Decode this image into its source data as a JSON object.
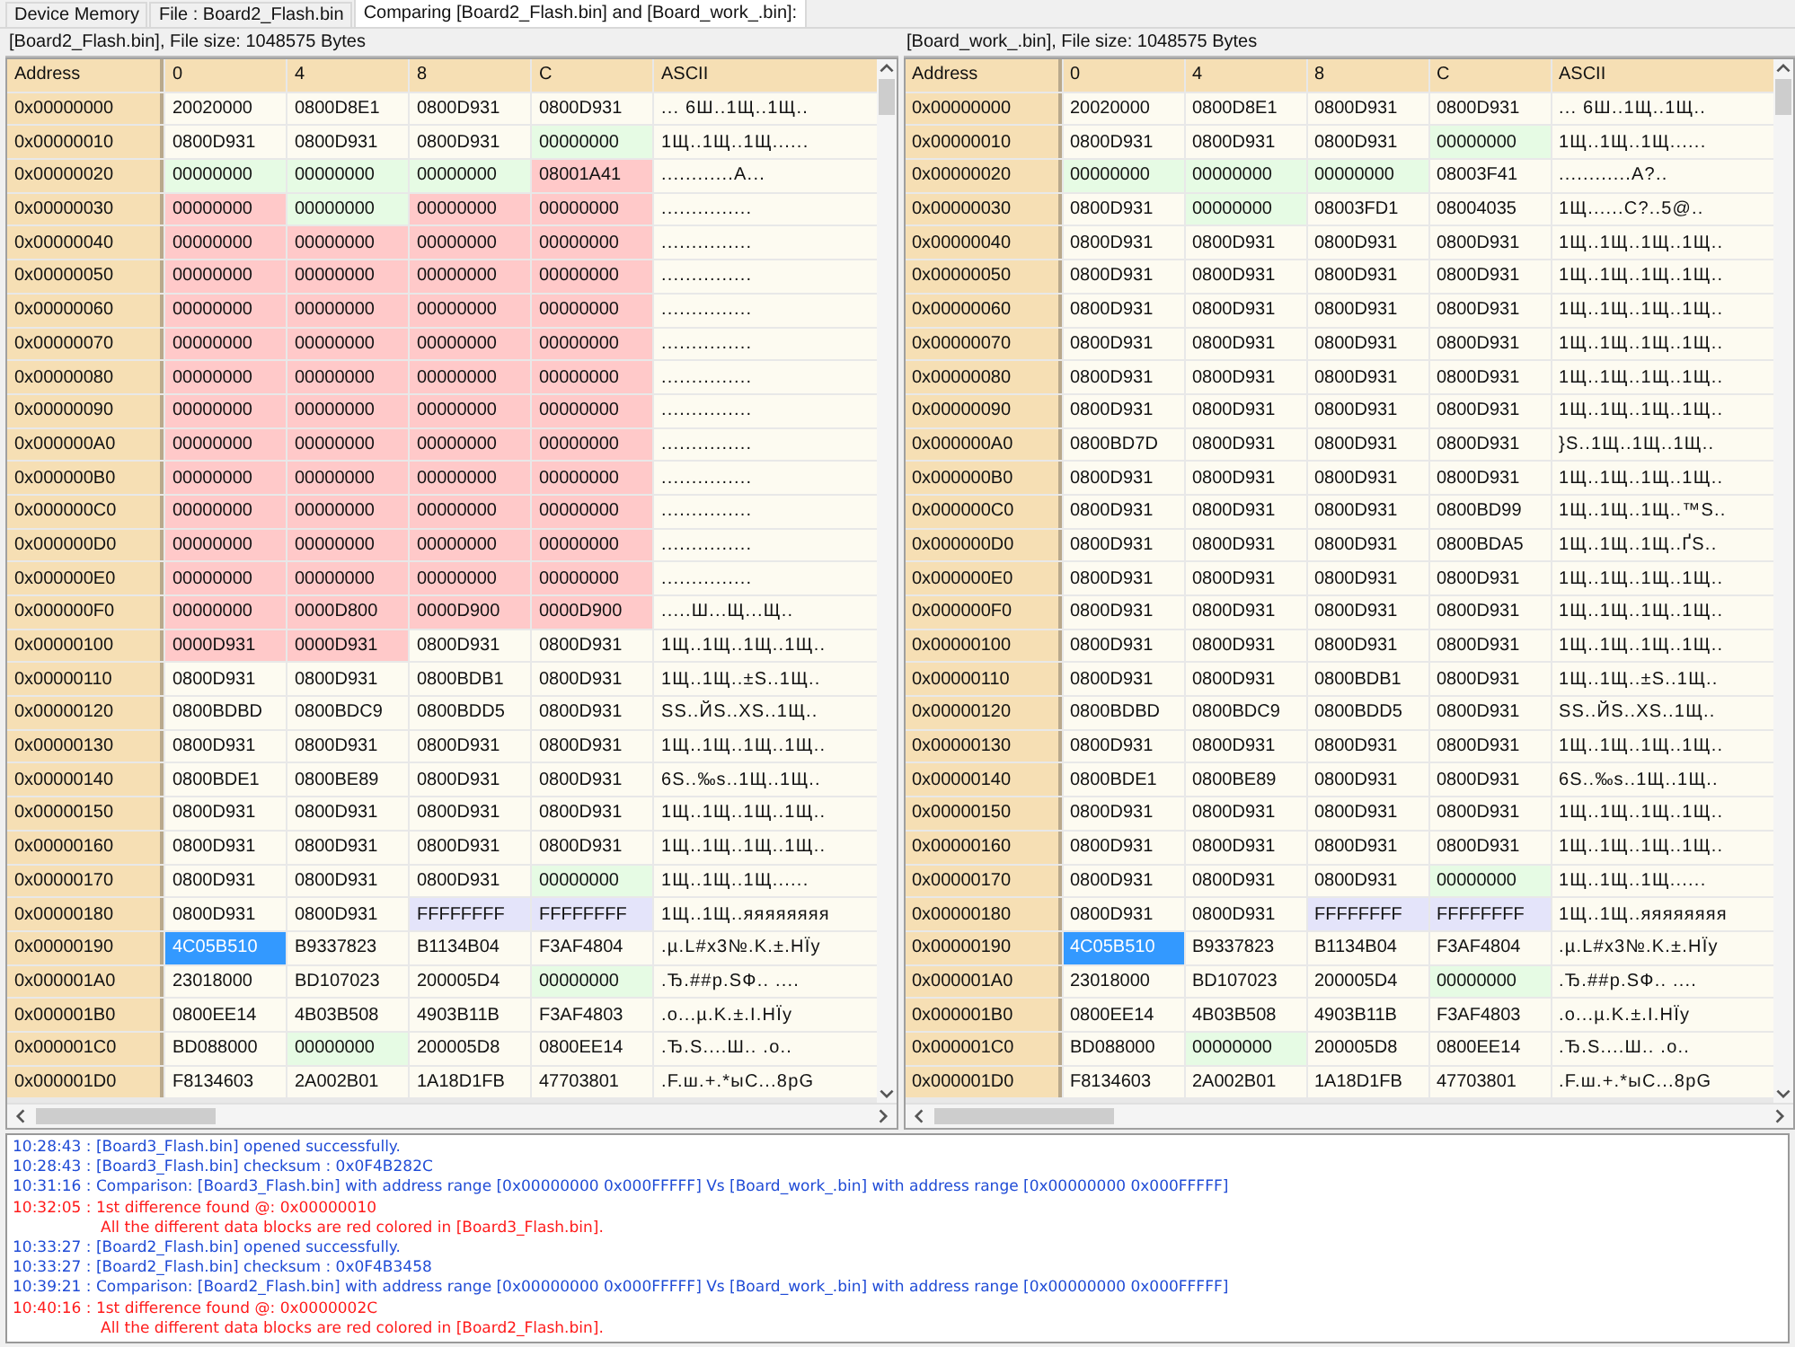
{
  "tabs": [
    {
      "label": "Device Memory",
      "selected": false
    },
    {
      "label": "File : Board2_Flash.bin",
      "selected": false
    },
    {
      "label": "Comparing [Board2_Flash.bin] and [Board_work_.bin]:",
      "selected": true
    }
  ],
  "panes": [
    {
      "title": "[Board2_Flash.bin], File size: 1048575 Bytes",
      "address_header": "Address",
      "columns": [
        "0",
        "4",
        "8",
        "C"
      ],
      "ascii_header": "ASCII",
      "rows": [
        {
          "address": "0x00000000",
          "cells": [
            {
              "value": "20020000",
              "color": "#fdfbf1"
            },
            {
              "value": "0800D8E1",
              "color": "#fdfbf1"
            },
            {
              "value": "0800D931",
              "color": "#fdfbf1"
            },
            {
              "value": "0800D931",
              "color": "#fdfbf1"
            }
          ],
          "ascii": "...  6Ш..1Щ..1Щ.."
        },
        {
          "address": "0x00000010",
          "cells": [
            {
              "value": "0800D931",
              "color": "#fdfbf1"
            },
            {
              "value": "0800D931",
              "color": "#fdfbf1"
            },
            {
              "value": "0800D931",
              "color": "#fdfbf1"
            },
            {
              "value": "00000000",
              "color": "#e6fbe4"
            }
          ],
          "ascii": "1Щ..1Щ..1Щ......"
        },
        {
          "address": "0x00000020",
          "cells": [
            {
              "value": "00000000",
              "color": "#e6fbe4"
            },
            {
              "value": "00000000",
              "color": "#e6fbe4"
            },
            {
              "value": "00000000",
              "color": "#e6fbe4"
            },
            {
              "value": "08001A41",
              "color": "#ffc9c9"
            }
          ],
          "ascii": "............A..."
        },
        {
          "address": "0x00000030",
          "cells": [
            {
              "value": "00000000",
              "color": "#ffc9c9"
            },
            {
              "value": "00000000",
              "color": "#e6fbe4"
            },
            {
              "value": "00000000",
              "color": "#ffc9c9"
            },
            {
              "value": "00000000",
              "color": "#ffc9c9"
            }
          ],
          "ascii": "..............."
        },
        {
          "address": "0x00000040",
          "cells": [
            {
              "value": "00000000",
              "color": "#ffc9c9"
            },
            {
              "value": "00000000",
              "color": "#ffc9c9"
            },
            {
              "value": "00000000",
              "color": "#ffc9c9"
            },
            {
              "value": "00000000",
              "color": "#ffc9c9"
            }
          ],
          "ascii": "..............."
        },
        {
          "address": "0x00000050",
          "cells": [
            {
              "value": "00000000",
              "color": "#ffc9c9"
            },
            {
              "value": "00000000",
              "color": "#ffc9c9"
            },
            {
              "value": "00000000",
              "color": "#ffc9c9"
            },
            {
              "value": "00000000",
              "color": "#ffc9c9"
            }
          ],
          "ascii": "..............."
        },
        {
          "address": "0x00000060",
          "cells": [
            {
              "value": "00000000",
              "color": "#ffc9c9"
            },
            {
              "value": "00000000",
              "color": "#ffc9c9"
            },
            {
              "value": "00000000",
              "color": "#ffc9c9"
            },
            {
              "value": "00000000",
              "color": "#ffc9c9"
            }
          ],
          "ascii": "..............."
        },
        {
          "address": "0x00000070",
          "cells": [
            {
              "value": "00000000",
              "color": "#ffc9c9"
            },
            {
              "value": "00000000",
              "color": "#ffc9c9"
            },
            {
              "value": "00000000",
              "color": "#ffc9c9"
            },
            {
              "value": "00000000",
              "color": "#ffc9c9"
            }
          ],
          "ascii": "..............."
        },
        {
          "address": "0x00000080",
          "cells": [
            {
              "value": "00000000",
              "color": "#ffc9c9"
            },
            {
              "value": "00000000",
              "color": "#ffc9c9"
            },
            {
              "value": "00000000",
              "color": "#ffc9c9"
            },
            {
              "value": "00000000",
              "color": "#ffc9c9"
            }
          ],
          "ascii": "..............."
        },
        {
          "address": "0x00000090",
          "cells": [
            {
              "value": "00000000",
              "color": "#ffc9c9"
            },
            {
              "value": "00000000",
              "color": "#ffc9c9"
            },
            {
              "value": "00000000",
              "color": "#ffc9c9"
            },
            {
              "value": "00000000",
              "color": "#ffc9c9"
            }
          ],
          "ascii": "..............."
        },
        {
          "address": "0x000000A0",
          "cells": [
            {
              "value": "00000000",
              "color": "#ffc9c9"
            },
            {
              "value": "00000000",
              "color": "#ffc9c9"
            },
            {
              "value": "00000000",
              "color": "#ffc9c9"
            },
            {
              "value": "00000000",
              "color": "#ffc9c9"
            }
          ],
          "ascii": "..............."
        },
        {
          "address": "0x000000B0",
          "cells": [
            {
              "value": "00000000",
              "color": "#ffc9c9"
            },
            {
              "value": "00000000",
              "color": "#ffc9c9"
            },
            {
              "value": "00000000",
              "color": "#ffc9c9"
            },
            {
              "value": "00000000",
              "color": "#ffc9c9"
            }
          ],
          "ascii": "..............."
        },
        {
          "address": "0x000000C0",
          "cells": [
            {
              "value": "00000000",
              "color": "#ffc9c9"
            },
            {
              "value": "00000000",
              "color": "#ffc9c9"
            },
            {
              "value": "00000000",
              "color": "#ffc9c9"
            },
            {
              "value": "00000000",
              "color": "#ffc9c9"
            }
          ],
          "ascii": "..............."
        },
        {
          "address": "0x000000D0",
          "cells": [
            {
              "value": "00000000",
              "color": "#ffc9c9"
            },
            {
              "value": "00000000",
              "color": "#ffc9c9"
            },
            {
              "value": "00000000",
              "color": "#ffc9c9"
            },
            {
              "value": "00000000",
              "color": "#ffc9c9"
            }
          ],
          "ascii": "..............."
        },
        {
          "address": "0x000000E0",
          "cells": [
            {
              "value": "00000000",
              "color": "#ffc9c9"
            },
            {
              "value": "00000000",
              "color": "#ffc9c9"
            },
            {
              "value": "00000000",
              "color": "#ffc9c9"
            },
            {
              "value": "00000000",
              "color": "#ffc9c9"
            }
          ],
          "ascii": "..............."
        },
        {
          "address": "0x000000F0",
          "cells": [
            {
              "value": "00000000",
              "color": "#ffc9c9"
            },
            {
              "value": "0000D800",
              "color": "#ffc9c9"
            },
            {
              "value": "0000D900",
              "color": "#ffc9c9"
            },
            {
              "value": "0000D900",
              "color": "#ffc9c9"
            }
          ],
          "ascii": ".....Ш...Щ...Щ.."
        },
        {
          "address": "0x00000100",
          "cells": [
            {
              "value": "0000D931",
              "color": "#ffc9c9"
            },
            {
              "value": "0000D931",
              "color": "#ffc9c9"
            },
            {
              "value": "0800D931",
              "color": "#fdfbf1"
            },
            {
              "value": "0800D931",
              "color": "#fdfbf1"
            }
          ],
          "ascii": "1Щ..1Щ..1Щ..1Щ.."
        },
        {
          "address": "0x00000110",
          "cells": [
            {
              "value": "0800D931",
              "color": "#fdfbf1"
            },
            {
              "value": "0800D931",
              "color": "#fdfbf1"
            },
            {
              "value": "0800BDB1",
              "color": "#fdfbf1"
            },
            {
              "value": "0800D931",
              "color": "#fdfbf1"
            }
          ],
          "ascii": "1Щ..1Щ..±S..1Щ.."
        },
        {
          "address": "0x00000120",
          "cells": [
            {
              "value": "0800BDBD",
              "color": "#fdfbf1"
            },
            {
              "value": "0800BDC9",
              "color": "#fdfbf1"
            },
            {
              "value": "0800BDD5",
              "color": "#fdfbf1"
            },
            {
              "value": "0800D931",
              "color": "#fdfbf1"
            }
          ],
          "ascii": "SS..ЙS..XS..1Щ.."
        },
        {
          "address": "0x00000130",
          "cells": [
            {
              "value": "0800D931",
              "color": "#fdfbf1"
            },
            {
              "value": "0800D931",
              "color": "#fdfbf1"
            },
            {
              "value": "0800D931",
              "color": "#fdfbf1"
            },
            {
              "value": "0800D931",
              "color": "#fdfbf1"
            }
          ],
          "ascii": "1Щ..1Щ..1Щ..1Щ.."
        },
        {
          "address": "0x00000140",
          "cells": [
            {
              "value": "0800BDE1",
              "color": "#fdfbf1"
            },
            {
              "value": "0800BE89",
              "color": "#fdfbf1"
            },
            {
              "value": "0800D931",
              "color": "#fdfbf1"
            },
            {
              "value": "0800D931",
              "color": "#fdfbf1"
            }
          ],
          "ascii": "6S..‰s..1Щ..1Щ.."
        },
        {
          "address": "0x00000150",
          "cells": [
            {
              "value": "0800D931",
              "color": "#fdfbf1"
            },
            {
              "value": "0800D931",
              "color": "#fdfbf1"
            },
            {
              "value": "0800D931",
              "color": "#fdfbf1"
            },
            {
              "value": "0800D931",
              "color": "#fdfbf1"
            }
          ],
          "ascii": "1Щ..1Щ..1Щ..1Щ.."
        },
        {
          "address": "0x00000160",
          "cells": [
            {
              "value": "0800D931",
              "color": "#fdfbf1"
            },
            {
              "value": "0800D931",
              "color": "#fdfbf1"
            },
            {
              "value": "0800D931",
              "color": "#fdfbf1"
            },
            {
              "value": "0800D931",
              "color": "#fdfbf1"
            }
          ],
          "ascii": "1Щ..1Щ..1Щ..1Щ.."
        },
        {
          "address": "0x00000170",
          "cells": [
            {
              "value": "0800D931",
              "color": "#fdfbf1"
            },
            {
              "value": "0800D931",
              "color": "#fdfbf1"
            },
            {
              "value": "0800D931",
              "color": "#fdfbf1"
            },
            {
              "value": "00000000",
              "color": "#e6fbe4"
            }
          ],
          "ascii": "1Щ..1Щ..1Щ......"
        },
        {
          "address": "0x00000180",
          "cells": [
            {
              "value": "0800D931",
              "color": "#fdfbf1"
            },
            {
              "value": "0800D931",
              "color": "#fdfbf1"
            },
            {
              "value": "FFFFFFFF",
              "color": "#e4e4fa"
            },
            {
              "value": "FFFFFFFF",
              "color": "#e4e4fa"
            }
          ],
          "ascii": "1Щ..1Щ..яяяяяяяя"
        },
        {
          "address": "0x00000190",
          "cells": [
            {
              "value": "4C05B510",
              "color": "#3399ff"
            },
            {
              "value": "B9337823",
              "color": "#fdfbf1"
            },
            {
              "value": "B1134B04",
              "color": "#fdfbf1"
            },
            {
              "value": "F3AF4804",
              "color": "#fdfbf1"
            }
          ],
          "ascii": ".µ.L#x3№.K.±.HЇy"
        },
        {
          "address": "0x000001A0",
          "cells": [
            {
              "value": "23018000",
              "color": "#fdfbf1"
            },
            {
              "value": "BD107023",
              "color": "#fdfbf1"
            },
            {
              "value": "200005D4",
              "color": "#fdfbf1"
            },
            {
              "value": "00000000",
              "color": "#e6fbe4"
            }
          ],
          "ascii": ".Ђ.##p.SФ.. ...."
        },
        {
          "address": "0x000001B0",
          "cells": [
            {
              "value": "0800EE14",
              "color": "#fdfbf1"
            },
            {
              "value": "4B03B508",
              "color": "#fdfbf1"
            },
            {
              "value": "4903B11B",
              "color": "#fdfbf1"
            },
            {
              "value": "F3AF4803",
              "color": "#fdfbf1"
            }
          ],
          "ascii": ".о...µ.K.±.I.HЇy"
        },
        {
          "address": "0x000001C0",
          "cells": [
            {
              "value": "BD088000",
              "color": "#fdfbf1"
            },
            {
              "value": "00000000",
              "color": "#e6fbe4"
            },
            {
              "value": "200005D8",
              "color": "#fdfbf1"
            },
            {
              "value": "0800EE14",
              "color": "#fdfbf1"
            }
          ],
          "ascii": ".Ђ.S....Ш.. .о.."
        },
        {
          "address": "0x000001D0",
          "cells": [
            {
              "value": "F8134603",
              "color": "#fdfbf1"
            },
            {
              "value": "2A002B01",
              "color": "#fdfbf1"
            },
            {
              "value": "1A18D1FB",
              "color": "#fdfbf1"
            },
            {
              "value": "47703801",
              "color": "#fdfbf1"
            }
          ],
          "ascii": ".F.ш.+.*ыC...8pG"
        }
      ]
    },
    {
      "title": "[Board_work_.bin], File size: 1048575 Bytes",
      "address_header": "Address",
      "columns": [
        "0",
        "4",
        "8",
        "C"
      ],
      "ascii_header": "ASCII",
      "rows": [
        {
          "address": "0x00000000",
          "cells": [
            {
              "value": "20020000",
              "color": "#fdfbf1"
            },
            {
              "value": "0800D8E1",
              "color": "#fdfbf1"
            },
            {
              "value": "0800D931",
              "color": "#fdfbf1"
            },
            {
              "value": "0800D931",
              "color": "#fdfbf1"
            }
          ],
          "ascii": "...  6Ш..1Щ..1Щ.."
        },
        {
          "address": "0x00000010",
          "cells": [
            {
              "value": "0800D931",
              "color": "#fdfbf1"
            },
            {
              "value": "0800D931",
              "color": "#fdfbf1"
            },
            {
              "value": "0800D931",
              "color": "#fdfbf1"
            },
            {
              "value": "00000000",
              "color": "#e6fbe4"
            }
          ],
          "ascii": "1Щ..1Щ..1Щ......"
        },
        {
          "address": "0x00000020",
          "cells": [
            {
              "value": "00000000",
              "color": "#e6fbe4"
            },
            {
              "value": "00000000",
              "color": "#e6fbe4"
            },
            {
              "value": "00000000",
              "color": "#e6fbe4"
            },
            {
              "value": "08003F41",
              "color": "#fdfbf1"
            }
          ],
          "ascii": "............A?.."
        },
        {
          "address": "0x00000030",
          "cells": [
            {
              "value": "0800D931",
              "color": "#fdfbf1"
            },
            {
              "value": "00000000",
              "color": "#e6fbe4"
            },
            {
              "value": "08003FD1",
              "color": "#fdfbf1"
            },
            {
              "value": "08004035",
              "color": "#fdfbf1"
            }
          ],
          "ascii": "1Щ......C?..5@.."
        },
        {
          "address": "0x00000040",
          "cells": [
            {
              "value": "0800D931",
              "color": "#fdfbf1"
            },
            {
              "value": "0800D931",
              "color": "#fdfbf1"
            },
            {
              "value": "0800D931",
              "color": "#fdfbf1"
            },
            {
              "value": "0800D931",
              "color": "#fdfbf1"
            }
          ],
          "ascii": "1Щ..1Щ..1Щ..1Щ.."
        },
        {
          "address": "0x00000050",
          "cells": [
            {
              "value": "0800D931",
              "color": "#fdfbf1"
            },
            {
              "value": "0800D931",
              "color": "#fdfbf1"
            },
            {
              "value": "0800D931",
              "color": "#fdfbf1"
            },
            {
              "value": "0800D931",
              "color": "#fdfbf1"
            }
          ],
          "ascii": "1Щ..1Щ..1Щ..1Щ.."
        },
        {
          "address": "0x00000060",
          "cells": [
            {
              "value": "0800D931",
              "color": "#fdfbf1"
            },
            {
              "value": "0800D931",
              "color": "#fdfbf1"
            },
            {
              "value": "0800D931",
              "color": "#fdfbf1"
            },
            {
              "value": "0800D931",
              "color": "#fdfbf1"
            }
          ],
          "ascii": "1Щ..1Щ..1Щ..1Щ.."
        },
        {
          "address": "0x00000070",
          "cells": [
            {
              "value": "0800D931",
              "color": "#fdfbf1"
            },
            {
              "value": "0800D931",
              "color": "#fdfbf1"
            },
            {
              "value": "0800D931",
              "color": "#fdfbf1"
            },
            {
              "value": "0800D931",
              "color": "#fdfbf1"
            }
          ],
          "ascii": "1Щ..1Щ..1Щ..1Щ.."
        },
        {
          "address": "0x00000080",
          "cells": [
            {
              "value": "0800D931",
              "color": "#fdfbf1"
            },
            {
              "value": "0800D931",
              "color": "#fdfbf1"
            },
            {
              "value": "0800D931",
              "color": "#fdfbf1"
            },
            {
              "value": "0800D931",
              "color": "#fdfbf1"
            }
          ],
          "ascii": "1Щ..1Щ..1Щ..1Щ.."
        },
        {
          "address": "0x00000090",
          "cells": [
            {
              "value": "0800D931",
              "color": "#fdfbf1"
            },
            {
              "value": "0800D931",
              "color": "#fdfbf1"
            },
            {
              "value": "0800D931",
              "color": "#fdfbf1"
            },
            {
              "value": "0800D931",
              "color": "#fdfbf1"
            }
          ],
          "ascii": "1Щ..1Щ..1Щ..1Щ.."
        },
        {
          "address": "0x000000A0",
          "cells": [
            {
              "value": "0800BD7D",
              "color": "#fdfbf1"
            },
            {
              "value": "0800D931",
              "color": "#fdfbf1"
            },
            {
              "value": "0800D931",
              "color": "#fdfbf1"
            },
            {
              "value": "0800D931",
              "color": "#fdfbf1"
            }
          ],
          "ascii": "}S..1Щ..1Щ..1Щ.."
        },
        {
          "address": "0x000000B0",
          "cells": [
            {
              "value": "0800D931",
              "color": "#fdfbf1"
            },
            {
              "value": "0800D931",
              "color": "#fdfbf1"
            },
            {
              "value": "0800D931",
              "color": "#fdfbf1"
            },
            {
              "value": "0800D931",
              "color": "#fdfbf1"
            }
          ],
          "ascii": "1Щ..1Щ..1Щ..1Щ.."
        },
        {
          "address": "0x000000C0",
          "cells": [
            {
              "value": "0800D931",
              "color": "#fdfbf1"
            },
            {
              "value": "0800D931",
              "color": "#fdfbf1"
            },
            {
              "value": "0800D931",
              "color": "#fdfbf1"
            },
            {
              "value": "0800BD99",
              "color": "#fdfbf1"
            }
          ],
          "ascii": "1Щ..1Щ..1Щ..™S.."
        },
        {
          "address": "0x000000D0",
          "cells": [
            {
              "value": "0800D931",
              "color": "#fdfbf1"
            },
            {
              "value": "0800D931",
              "color": "#fdfbf1"
            },
            {
              "value": "0800D931",
              "color": "#fdfbf1"
            },
            {
              "value": "0800BDA5",
              "color": "#fdfbf1"
            }
          ],
          "ascii": "1Щ..1Щ..1Щ..ҐS.."
        },
        {
          "address": "0x000000E0",
          "cells": [
            {
              "value": "0800D931",
              "color": "#fdfbf1"
            },
            {
              "value": "0800D931",
              "color": "#fdfbf1"
            },
            {
              "value": "0800D931",
              "color": "#fdfbf1"
            },
            {
              "value": "0800D931",
              "color": "#fdfbf1"
            }
          ],
          "ascii": "1Щ..1Щ..1Щ..1Щ.."
        },
        {
          "address": "0x000000F0",
          "cells": [
            {
              "value": "0800D931",
              "color": "#fdfbf1"
            },
            {
              "value": "0800D931",
              "color": "#fdfbf1"
            },
            {
              "value": "0800D931",
              "color": "#fdfbf1"
            },
            {
              "value": "0800D931",
              "color": "#fdfbf1"
            }
          ],
          "ascii": "1Щ..1Щ..1Щ..1Щ.."
        },
        {
          "address": "0x00000100",
          "cells": [
            {
              "value": "0800D931",
              "color": "#fdfbf1"
            },
            {
              "value": "0800D931",
              "color": "#fdfbf1"
            },
            {
              "value": "0800D931",
              "color": "#fdfbf1"
            },
            {
              "value": "0800D931",
              "color": "#fdfbf1"
            }
          ],
          "ascii": "1Щ..1Щ..1Щ..1Щ.."
        },
        {
          "address": "0x00000110",
          "cells": [
            {
              "value": "0800D931",
              "color": "#fdfbf1"
            },
            {
              "value": "0800D931",
              "color": "#fdfbf1"
            },
            {
              "value": "0800BDB1",
              "color": "#fdfbf1"
            },
            {
              "value": "0800D931",
              "color": "#fdfbf1"
            }
          ],
          "ascii": "1Щ..1Щ..±S..1Щ.."
        },
        {
          "address": "0x00000120",
          "cells": [
            {
              "value": "0800BDBD",
              "color": "#fdfbf1"
            },
            {
              "value": "0800BDC9",
              "color": "#fdfbf1"
            },
            {
              "value": "0800BDD5",
              "color": "#fdfbf1"
            },
            {
              "value": "0800D931",
              "color": "#fdfbf1"
            }
          ],
          "ascii": "SS..ЙS..XS..1Щ.."
        },
        {
          "address": "0x00000130",
          "cells": [
            {
              "value": "0800D931",
              "color": "#fdfbf1"
            },
            {
              "value": "0800D931",
              "color": "#fdfbf1"
            },
            {
              "value": "0800D931",
              "color": "#fdfbf1"
            },
            {
              "value": "0800D931",
              "color": "#fdfbf1"
            }
          ],
          "ascii": "1Щ..1Щ..1Щ..1Щ.."
        },
        {
          "address": "0x00000140",
          "cells": [
            {
              "value": "0800BDE1",
              "color": "#fdfbf1"
            },
            {
              "value": "0800BE89",
              "color": "#fdfbf1"
            },
            {
              "value": "0800D931",
              "color": "#fdfbf1"
            },
            {
              "value": "0800D931",
              "color": "#fdfbf1"
            }
          ],
          "ascii": "6S..‰s..1Щ..1Щ.."
        },
        {
          "address": "0x00000150",
          "cells": [
            {
              "value": "0800D931",
              "color": "#fdfbf1"
            },
            {
              "value": "0800D931",
              "color": "#fdfbf1"
            },
            {
              "value": "0800D931",
              "color": "#fdfbf1"
            },
            {
              "value": "0800D931",
              "color": "#fdfbf1"
            }
          ],
          "ascii": "1Щ..1Щ..1Щ..1Щ.."
        },
        {
          "address": "0x00000160",
          "cells": [
            {
              "value": "0800D931",
              "color": "#fdfbf1"
            },
            {
              "value": "0800D931",
              "color": "#fdfbf1"
            },
            {
              "value": "0800D931",
              "color": "#fdfbf1"
            },
            {
              "value": "0800D931",
              "color": "#fdfbf1"
            }
          ],
          "ascii": "1Щ..1Щ..1Щ..1Щ.."
        },
        {
          "address": "0x00000170",
          "cells": [
            {
              "value": "0800D931",
              "color": "#fdfbf1"
            },
            {
              "value": "0800D931",
              "color": "#fdfbf1"
            },
            {
              "value": "0800D931",
              "color": "#fdfbf1"
            },
            {
              "value": "00000000",
              "color": "#e6fbe4"
            }
          ],
          "ascii": "1Щ..1Щ..1Щ......"
        },
        {
          "address": "0x00000180",
          "cells": [
            {
              "value": "0800D931",
              "color": "#fdfbf1"
            },
            {
              "value": "0800D931",
              "color": "#fdfbf1"
            },
            {
              "value": "FFFFFFFF",
              "color": "#e4e4fa"
            },
            {
              "value": "FFFFFFFF",
              "color": "#e4e4fa"
            }
          ],
          "ascii": "1Щ..1Щ..яяяяяяяя"
        },
        {
          "address": "0x00000190",
          "cells": [
            {
              "value": "4C05B510",
              "color": "#3399ff"
            },
            {
              "value": "B9337823",
              "color": "#fdfbf1"
            },
            {
              "value": "B1134B04",
              "color": "#fdfbf1"
            },
            {
              "value": "F3AF4804",
              "color": "#fdfbf1"
            }
          ],
          "ascii": ".µ.L#x3№.K.±.HЇy"
        },
        {
          "address": "0x000001A0",
          "cells": [
            {
              "value": "23018000",
              "color": "#fdfbf1"
            },
            {
              "value": "BD107023",
              "color": "#fdfbf1"
            },
            {
              "value": "200005D4",
              "color": "#fdfbf1"
            },
            {
              "value": "00000000",
              "color": "#e6fbe4"
            }
          ],
          "ascii": ".Ђ.##p.SФ.. ...."
        },
        {
          "address": "0x000001B0",
          "cells": [
            {
              "value": "0800EE14",
              "color": "#fdfbf1"
            },
            {
              "value": "4B03B508",
              "color": "#fdfbf1"
            },
            {
              "value": "4903B11B",
              "color": "#fdfbf1"
            },
            {
              "value": "F3AF4803",
              "color": "#fdfbf1"
            }
          ],
          "ascii": ".о...µ.K.±.I.HЇy"
        },
        {
          "address": "0x000001C0",
          "cells": [
            {
              "value": "BD088000",
              "color": "#fdfbf1"
            },
            {
              "value": "00000000",
              "color": "#e6fbe4"
            },
            {
              "value": "200005D8",
              "color": "#fdfbf1"
            },
            {
              "value": "0800EE14",
              "color": "#fdfbf1"
            }
          ],
          "ascii": ".Ђ.S....Ш.. .о.."
        },
        {
          "address": "0x000001D0",
          "cells": [
            {
              "value": "F8134603",
              "color": "#fdfbf1"
            },
            {
              "value": "2A002B01",
              "color": "#fdfbf1"
            },
            {
              "value": "1A18D1FB",
              "color": "#fdfbf1"
            },
            {
              "value": "47703801",
              "color": "#fdfbf1"
            }
          ],
          "ascii": ".F.ш.+.*ыC...8pG"
        }
      ]
    }
  ],
  "log": [
    {
      "kind": "info",
      "text": "10:28:43 : [Board3_Flash.bin] opened successfully."
    },
    {
      "kind": "info",
      "text": "10:28:43 : [Board3_Flash.bin] checksum : 0x0F4B282C"
    },
    {
      "kind": "info",
      "text": "10:31:16 : Comparison: [Board3_Flash.bin] with address range [0x00000000 0x000FFFFF] Vs [Board_work_.bin] with address range [0x00000000 0x000FFFFF]"
    },
    {
      "kind": "error",
      "text": "10:32:05 : 1st difference found @: 0x00000010",
      "note": "All the different data blocks are red colored in [Board3_Flash.bin]."
    },
    {
      "kind": "info",
      "text": "10:33:27 : [Board2_Flash.bin] opened successfully."
    },
    {
      "kind": "info",
      "text": "10:33:27 : [Board2_Flash.bin] checksum : 0x0F4B3458"
    },
    {
      "kind": "info",
      "text": "10:39:21 : Comparison: [Board2_Flash.bin] with address range [0x00000000 0x000FFFFF] Vs [Board_work_.bin] with address range [0x00000000 0x000FFFFF]"
    },
    {
      "kind": "error",
      "text": "10:40:16 : 1st difference found @: 0x0000002C",
      "note": "All the different data blocks are red colored in [Board2_Flash.bin]."
    }
  ]
}
